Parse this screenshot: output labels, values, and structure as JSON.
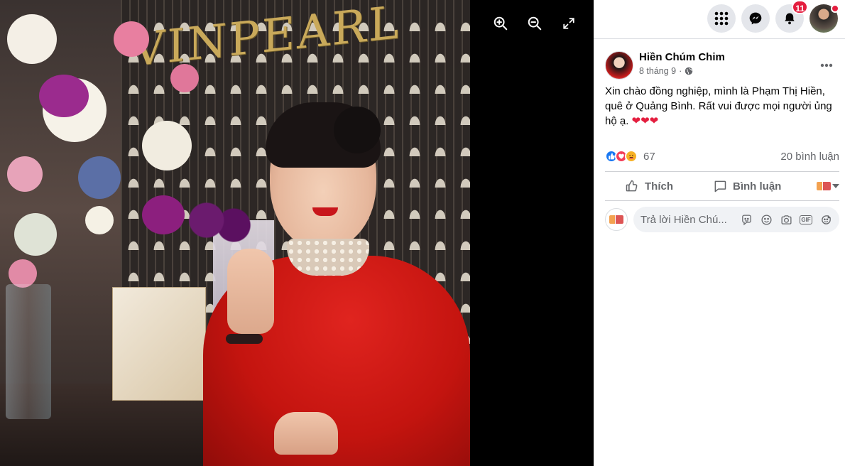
{
  "viewer": {
    "photo_sign_text": "VINPEARL",
    "tools": [
      {
        "name": "zoom-in-button",
        "icon": "zoom-in-icon"
      },
      {
        "name": "zoom-out-button",
        "icon": "zoom-out-icon"
      },
      {
        "name": "fullscreen-button",
        "icon": "fullscreen-icon"
      }
    ]
  },
  "topbar": {
    "menu_icon": "grid-menu-icon",
    "messenger_icon": "messenger-icon",
    "notifications_icon": "bell-icon",
    "notification_count": "11",
    "accent_color": "#e41e3f"
  },
  "post": {
    "author": "Hiền Chúm Chim",
    "date": "8 tháng 9",
    "separator": "·",
    "privacy_icon": "globe-icon",
    "text": "Xin chào đồng nghiệp, mình là Phạm Thị Hiền, quê ở Quảng Bình. Rất vui được mọi người ủng hộ ạ.",
    "emoji": "❤❤❤",
    "reaction_count": "67",
    "comment_count": "20 bình luận",
    "like_label": "Thích",
    "comment_label": "Bình luận"
  },
  "reply": {
    "placeholder": "Trả lời Hiền Chú..."
  }
}
